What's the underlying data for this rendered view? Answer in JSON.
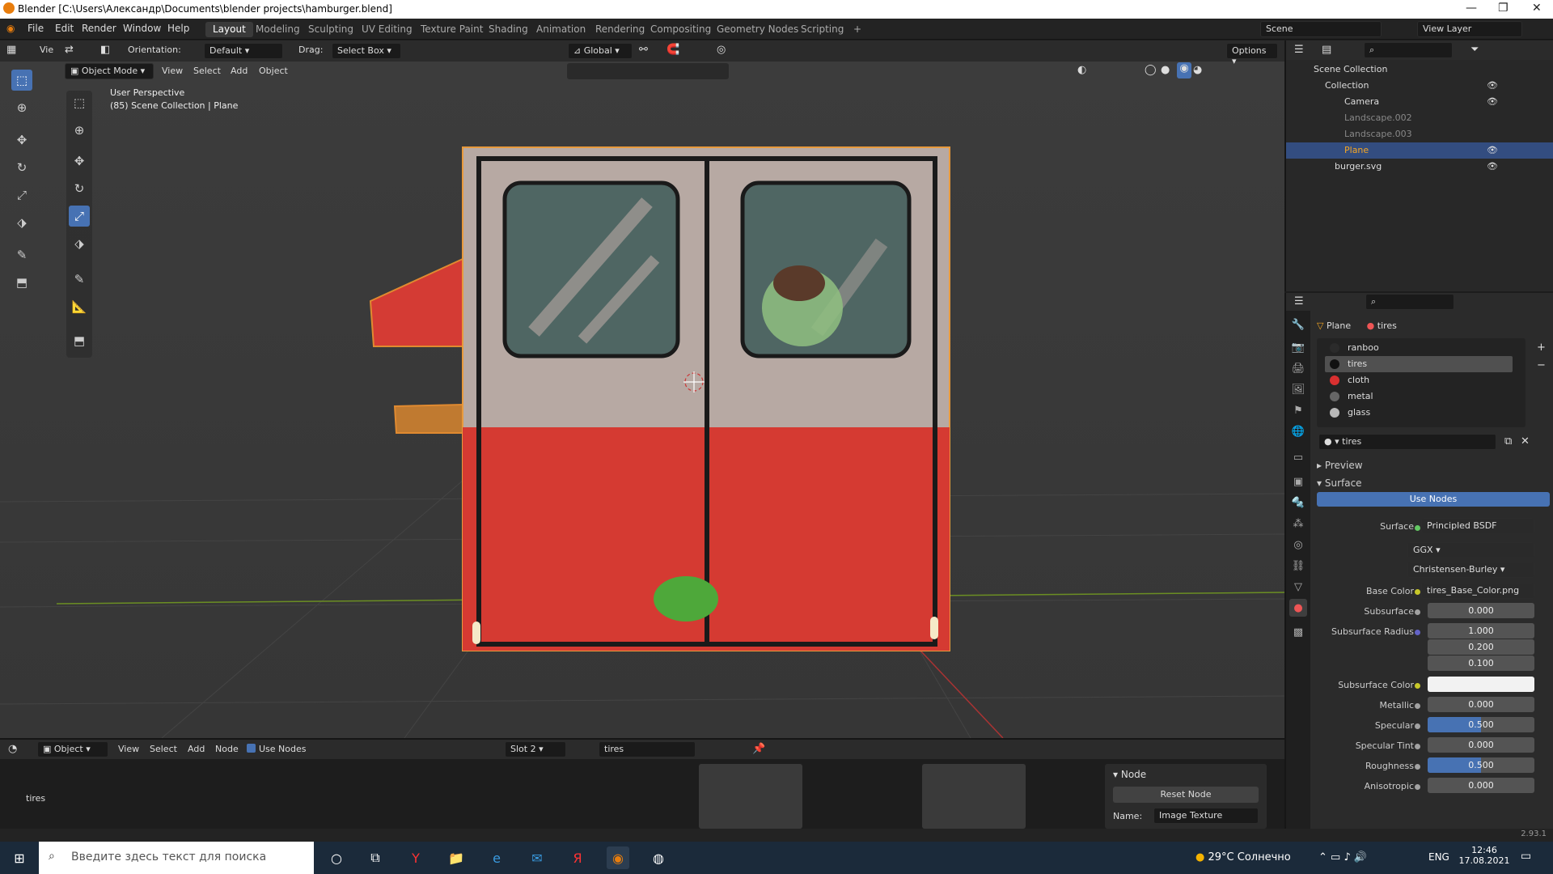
{
  "window": {
    "title": "Blender [C:\\Users\\Александр\\Documents\\blender projects\\hamburger.blend]"
  },
  "menus": [
    "File",
    "Edit",
    "Render",
    "Window",
    "Help"
  ],
  "workspaces": [
    "Layout",
    "Modeling",
    "Sculpting",
    "UV Editing",
    "Texture Paint",
    "Shading",
    "Animation",
    "Rendering",
    "Compositing",
    "Geometry Nodes",
    "Scripting"
  ],
  "scene": "Scene",
  "view_layer": "View Layer",
  "header": {
    "orientation_label": "Orientation:",
    "orientation_value": "Default",
    "drag_label": "Drag:",
    "drag_value": "Select Box",
    "transform_orientation": "Global",
    "options": "Options",
    "view_label_cut": "Vie"
  },
  "viewport": {
    "mode": "Object Mode",
    "menus": [
      "View",
      "Select",
      "Add",
      "Object"
    ],
    "info_line1": "User Perspective",
    "info_line2": "(85) Scene Collection | Plane"
  },
  "outliner": {
    "rows": [
      {
        "label": "Scene Collection",
        "selected": false
      },
      {
        "label": "Collection",
        "selected": false
      },
      {
        "label": "Camera",
        "selected": false
      },
      {
        "label": "Landscape.002",
        "selected": false
      },
      {
        "label": "Landscape.003",
        "selected": false
      },
      {
        "label": "Plane",
        "selected": true
      },
      {
        "label": "burger.svg",
        "selected": false
      }
    ]
  },
  "properties": {
    "breadcrumb_object": "Plane",
    "breadcrumb_material": "tires",
    "slots": [
      {
        "name": "ranboo",
        "color": "#2b2b2b"
      },
      {
        "name": "tires",
        "color": "#111111"
      },
      {
        "name": "cloth",
        "color": "#d93030"
      },
      {
        "name": "metal",
        "color": "#666666"
      },
      {
        "name": "glass",
        "color": "#b8b8b8"
      }
    ],
    "material_name": "tires",
    "preview": "Preview",
    "surface_panel": "Surface",
    "use_nodes": "Use Nodes",
    "surface_label": "Surface",
    "surface_value": "Principled BSDF",
    "distribution": "GGX",
    "subsurface_method": "Christensen-Burley",
    "params": [
      {
        "label": "Base Color",
        "value": "tires_Base_Color.png",
        "fill": 0
      },
      {
        "label": "Subsurface",
        "value": "0.000",
        "fill": 0
      },
      {
        "label": "Subsurface Radius",
        "value": "1.000",
        "fill": 0
      },
      {
        "label": "",
        "value": "0.200",
        "fill": 0
      },
      {
        "label": "",
        "value": "0.100",
        "fill": 0
      },
      {
        "label": "Subsurface Color",
        "value": "",
        "fill": 0
      },
      {
        "label": "Metallic",
        "value": "0.000",
        "fill": 0
      },
      {
        "label": "Specular",
        "value": "0.500",
        "fill": 0.5
      },
      {
        "label": "Specular Tint",
        "value": "0.000",
        "fill": 0
      },
      {
        "label": "Roughness",
        "value": "0.500",
        "fill": 0.5
      },
      {
        "label": "Anisotropic",
        "value": "0.000",
        "fill": 0
      }
    ]
  },
  "shader_editor": {
    "editor": "Object",
    "menus": [
      "View",
      "Select",
      "Add",
      "Node"
    ],
    "use_nodes": "Use Nodes",
    "slot": "Slot 2",
    "material": "tires",
    "node_panel_title": "Node",
    "reset_node": "Reset Node",
    "name_label": "Name:",
    "name_value": "Image Texture",
    "frame_label": "tires"
  },
  "status": {
    "version": "2.93.1"
  },
  "taskbar": {
    "search_placeholder": "Введите здесь текст для поиска",
    "weather": "29°C  Солнечно",
    "lang": "ENG",
    "time": "12:46",
    "date": "17.08.2021"
  }
}
